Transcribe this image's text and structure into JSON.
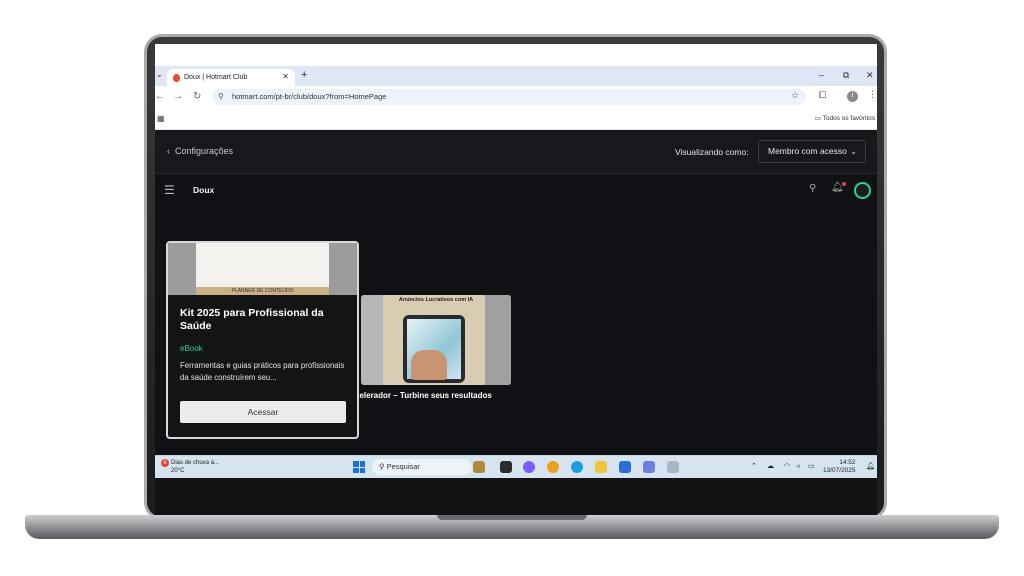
{
  "browser": {
    "tab_title": "Doux | Hotmart Club",
    "url": "hotmart.com/pt-br/club/doux?from=HomePage",
    "bookmarks_label": "Todos os favoritos",
    "new_tab_symbol": "+",
    "close_symbol": "✕"
  },
  "config_bar": {
    "back_label": "Configurações",
    "viewing_as_label": "Visualizando como:",
    "viewing_as_value": "Membro com acesso"
  },
  "club": {
    "name": "Doux"
  },
  "cards": [
    {
      "title": "Kit 2025 para Profissional da Saúde",
      "type": "eBook",
      "description": "Ferramentas e guias práticos para profissionais da saúde construírem seu...",
      "action_label": "Acessar",
      "thumb_strip_text": "PLANNER DE CONTEÚDO"
    },
    {
      "thumb_title": "Anúncios Lucrativos com IA",
      "title": "celerador – Turbine seus resultados"
    }
  ],
  "taskbar": {
    "weather_badge": "6",
    "weather_text": "Dias de chuva à...",
    "weather_temp": "20°C",
    "search_placeholder": "Pesquisar",
    "time": "14:52",
    "date": "13/07/2025"
  },
  "colors": {
    "accent_green": "#2fd28a",
    "page_bg": "#101114",
    "taskbar_bg": "#d6e4ef"
  }
}
